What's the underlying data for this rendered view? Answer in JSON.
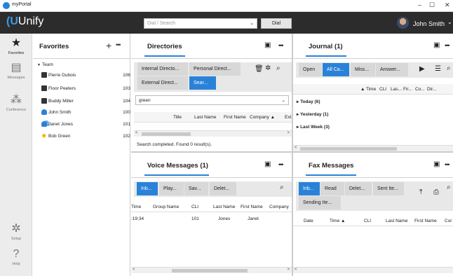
{
  "window": {
    "title": "myPortal",
    "controls": [
      "–",
      "☐",
      "✕"
    ]
  },
  "header": {
    "brand": "Unify",
    "search_placeholder": "Dial / Search",
    "dial_label": "Dial",
    "user_name": "John Smith"
  },
  "nav": [
    {
      "label": "Favorites",
      "icon": "star-icon"
    },
    {
      "label": "Messages",
      "icon": "messages-icon"
    },
    {
      "label": "Conference",
      "icon": "conference-icon"
    },
    {
      "label": "Setup",
      "icon": "gear-icon"
    },
    {
      "label": "Help",
      "icon": "help-icon"
    }
  ],
  "favorites": {
    "title": "Favorites",
    "group": "Team",
    "items": [
      {
        "name": "Pierre Dubois",
        "ext": "106",
        "icon": "phone-icon"
      },
      {
        "name": "Floor Peeters",
        "ext": "103",
        "icon": "phone-icon"
      },
      {
        "name": "Buddy Miller",
        "ext": "104",
        "icon": "phone-icon"
      },
      {
        "name": "John Smith",
        "ext": "100",
        "icon": "person-icon"
      },
      {
        "name": "Janet Jones",
        "ext": "101",
        "icon": "people-icon"
      },
      {
        "name": "Bob Green",
        "ext": "102",
        "icon": "sun-icon"
      }
    ]
  },
  "directories": {
    "title": "Directories",
    "tabs": [
      "Internal Directo...",
      "Personal Direct...",
      "External Direct...",
      "Sear..."
    ],
    "search_value": "green",
    "columns": [
      "Title",
      "Last Name",
      "First Name",
      "Company ▲",
      "Ext"
    ],
    "status": "Search completed. Found 0 result(s)."
  },
  "journal": {
    "title": "Journal (1)",
    "tabs": [
      "Open",
      "All Ca...",
      "Miss...",
      "Answer..."
    ],
    "columns": [
      "▲",
      "Time",
      "CLI",
      "Las...",
      "Fir...",
      "Co...",
      "Dir..."
    ],
    "groups": [
      "Today (6)",
      "Yesterday (1)",
      "Last Week (3)"
    ]
  },
  "voice": {
    "title": "Voice Messages (1)",
    "tabs": [
      "Inb...",
      "Play...",
      "Sav...",
      "Delet..."
    ],
    "columns": [
      "Time",
      "Group Name",
      "CLI",
      "Last Name",
      "First Name",
      "Company"
    ],
    "rows": [
      {
        "time": ":19:34",
        "group": "",
        "cli": "101",
        "last": "Jones",
        "first": "Janet",
        "company": ""
      }
    ]
  },
  "fax": {
    "title": "Fax Messages",
    "tabs": [
      "Inb...",
      "Read",
      "Delet...",
      "Sent Ite...",
      "Sending Ite..."
    ],
    "columns": [
      "Date",
      "Time ▲",
      "CLI",
      "Last Name",
      "First Name",
      "Cor"
    ]
  }
}
